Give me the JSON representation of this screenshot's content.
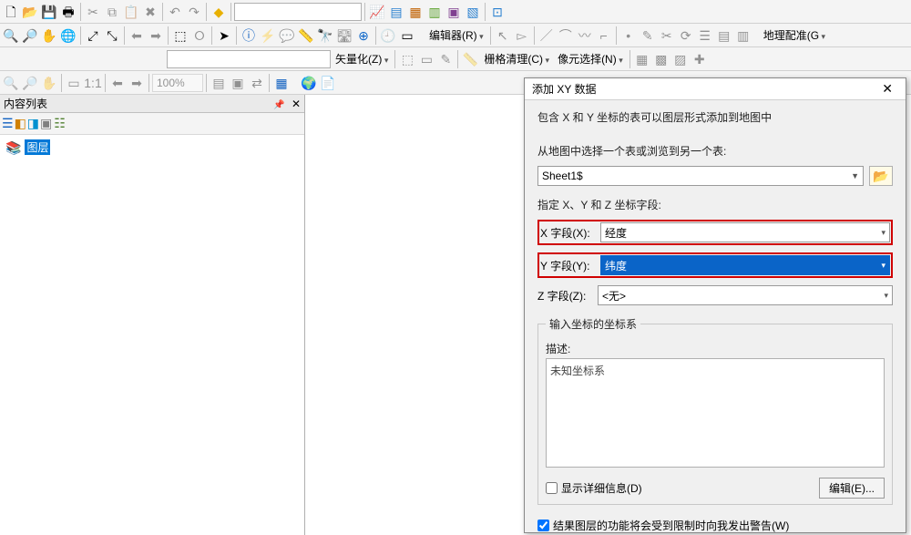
{
  "toolbars": {
    "row1_combo_value": "",
    "menu_editor": "编辑器(R)",
    "menu_georef": "地理配准(G",
    "menu_vectorize": "矢量化(Z)",
    "menu_raster_cleanup": "栅格清理(C)",
    "menu_cell_selection": "像元选择(N)",
    "zoom_value": "100%"
  },
  "toc": {
    "title": "内容列表",
    "root_label": "图层"
  },
  "dialog": {
    "title": "添加 XY 数据",
    "description": "包含 X 和 Y 坐标的表可以图层形式添加到地图中",
    "choose_table_label": "从地图中选择一个表或浏览到另一个表:",
    "table_value": "Sheet1$",
    "fields_label": "指定 X、Y 和 Z 坐标字段:",
    "x_label": "X 字段(X):",
    "x_value": "经度",
    "y_label": "Y 字段(Y):",
    "y_value": "纬度",
    "z_label": "Z 字段(Z):",
    "z_value": "<无>",
    "crs_legend": "输入坐标的坐标系",
    "crs_desc_label": "描述:",
    "crs_desc_value": "未知坐标系",
    "show_details_label": "显示详细信息(D)",
    "edit_button": "编辑(E)...",
    "warn_label": "结果图层的功能将会受到限制时向我发出警告(W)"
  }
}
